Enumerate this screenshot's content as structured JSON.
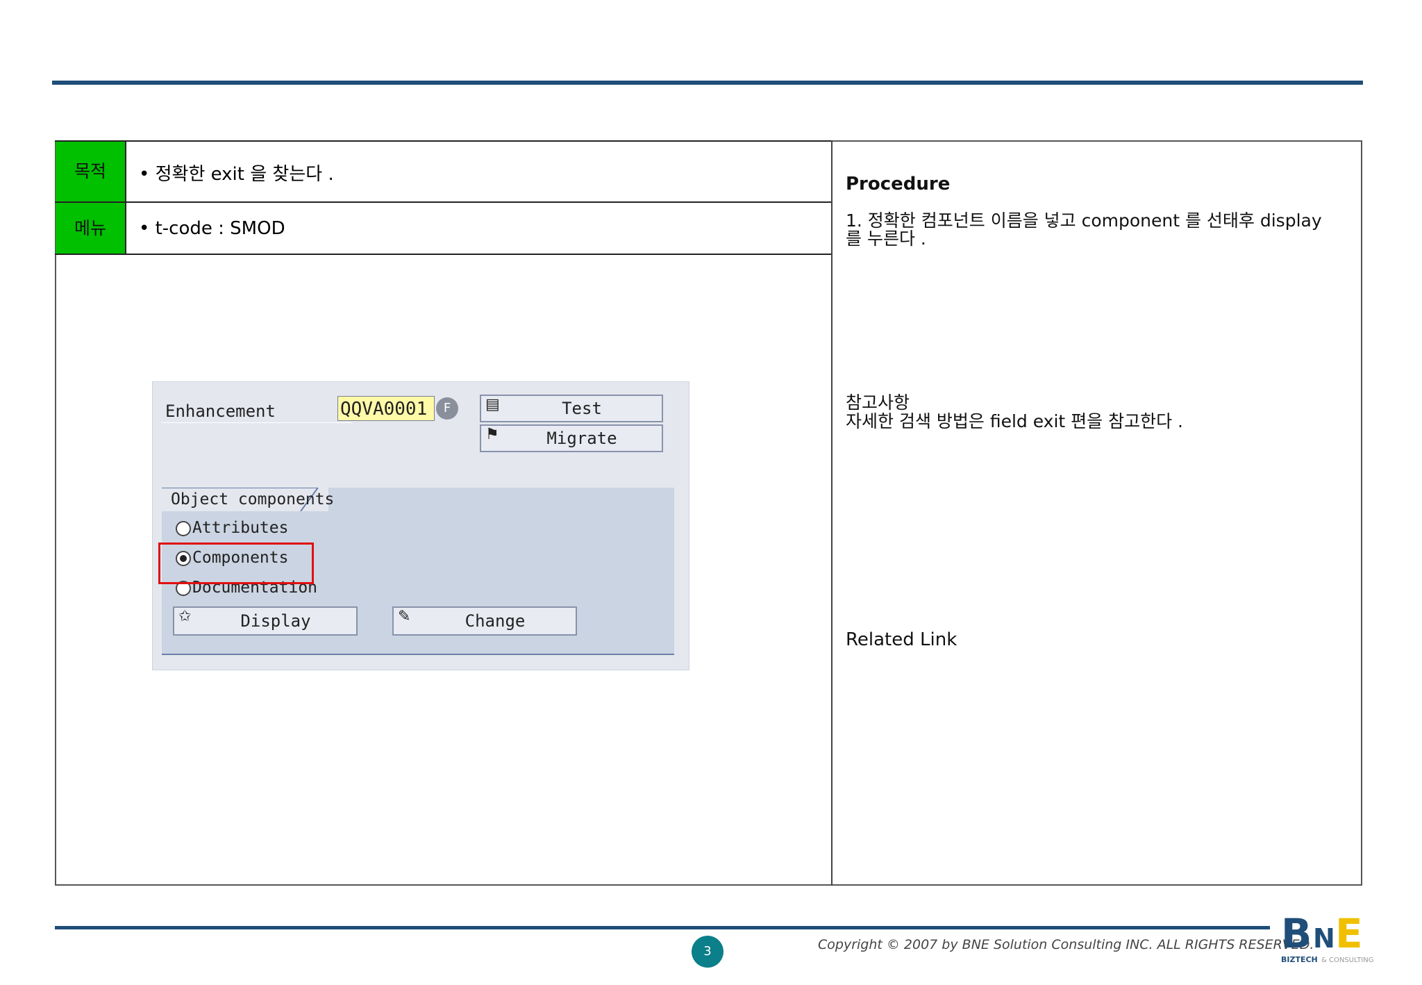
{
  "table": {
    "purpose_label": "목적",
    "purpose_text": "• 정확한 exit 을 찾는다 .",
    "menu_label": "메뉴",
    "menu_text": "• t-code : SMOD"
  },
  "sap": {
    "enhancement_label": "Enhancement",
    "enhancement_value": "QQVA0001",
    "test_label": "Test",
    "migrate_label": "Migrate",
    "group_title": "Object components",
    "radios": [
      "Attributes",
      "Components",
      "Documentation"
    ],
    "selected_radio": "Components",
    "display_label": "Display",
    "change_label": "Change"
  },
  "right": {
    "procedure_title": "Procedure",
    "procedure_step": "1. 정확한 컴포넌트 이름을 넣고 component 를 선태후 display 를 누른다 .",
    "note_title": "참고사항",
    "note_text": "자세한 검색 방법은 field exit 편을 참고한다 .",
    "related_link": "Related Link"
  },
  "footer": {
    "page_number": "3",
    "copyright": "Copyright © 2007 by BNE Solution Consulting INC.   ALL RIGHTS RESERVED.",
    "logo_text": "BNE",
    "logo_subtext": "BIZTECH & CONSULTING"
  },
  "colors": {
    "accent_rule": "#1f4e79",
    "label_green": "#00c000",
    "page_num_bg": "#0b7f8a",
    "highlight_red": "#e01010"
  }
}
